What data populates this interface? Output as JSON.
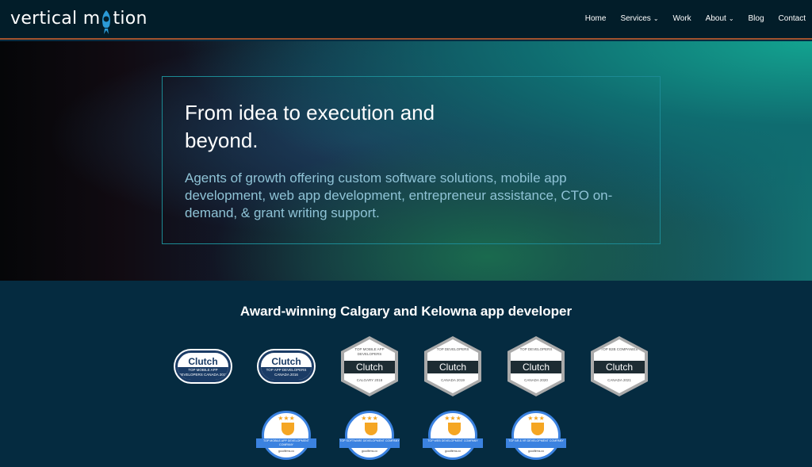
{
  "brand": {
    "name_left": "vertical m",
    "name_right": "tion",
    "accent": "#2b9ad6"
  },
  "nav": {
    "items": [
      {
        "label": "Home"
      },
      {
        "label": "Services",
        "dropdown": true
      },
      {
        "label": "Work"
      },
      {
        "label": "About",
        "dropdown": true
      },
      {
        "label": "Blog"
      },
      {
        "label": "Contact"
      }
    ]
  },
  "hero": {
    "title": "From idea to execution and beyond.",
    "subtitle": "Agents of growth offering custom software solutions, mobile app development, web app development, entrepreneur assistance, CTO on-demand, & grant writing support."
  },
  "awards": {
    "title": "Award-winning Calgary and Kelowna app developer",
    "clutch_ovals": [
      {
        "brand": "Clutch",
        "text": "TOP MOBILE APP DEVELOPERS CANADA 2018"
      },
      {
        "brand": "Clutch",
        "text": "TOP APP DEVELOPERS CANADA 2016"
      }
    ],
    "clutch_hexes": [
      {
        "top": "TOP MOBILE APP DEVELOPERS",
        "brand": "Clutch",
        "bottom": "CALGARY 2018"
      },
      {
        "top": "TOP DEVELOPERS",
        "brand": "Clutch",
        "bottom": "CANADA 2019"
      },
      {
        "top": "TOP DEVELOPERS",
        "brand": "Clutch",
        "bottom": "CANADA 2020"
      },
      {
        "top": "TOP B2B COMPANIES",
        "brand": "Clutch",
        "bottom": "CANADA 2021"
      }
    ],
    "goodfirms": [
      {
        "text": "TOP MOBILE APP DEVELOPMENT COMPANY",
        "brand": "goodfirms.co"
      },
      {
        "text": "TOP SOFTWARE DEVELOPMENT COMPANY",
        "brand": "goodfirms.co"
      },
      {
        "text": "TOP WEB DEVELOPMENT COMPANY",
        "brand": "goodfirms.co"
      },
      {
        "text": "TOP AR & VR DEVELOPMENT COMPANY",
        "brand": "goodfirms.co"
      }
    ]
  }
}
